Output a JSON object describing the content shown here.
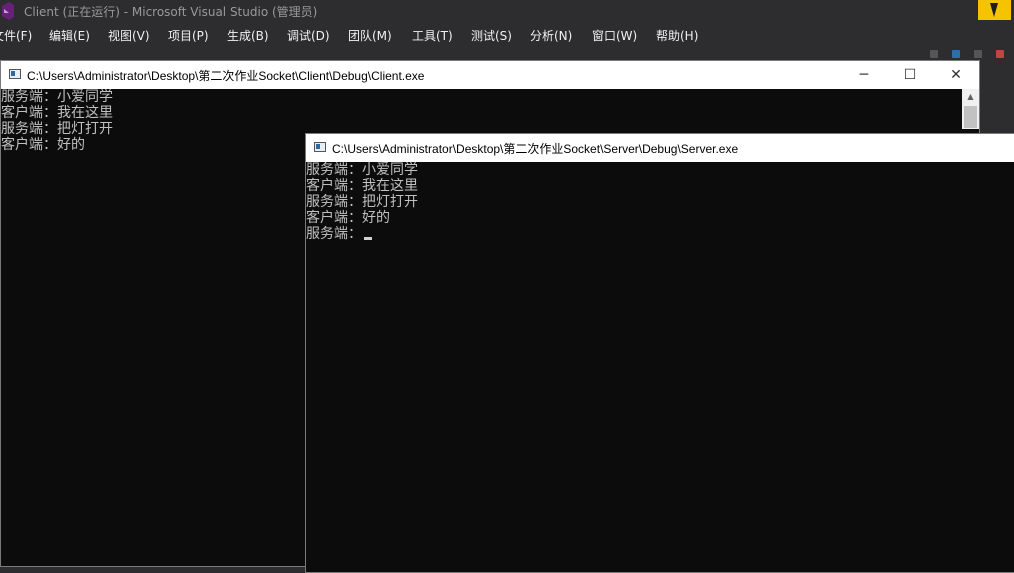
{
  "vs": {
    "title": "Client (正在运行) - Microsoft Visual Studio (管理员)",
    "menu": [
      "文件(F)",
      "编辑(E)",
      "视图(V)",
      "项目(P)",
      "生成(B)",
      "调试(D)",
      "团队(M)",
      "工具(T)",
      "测试(S)",
      "分析(N)",
      "窗口(W)",
      "帮助(H)"
    ]
  },
  "client": {
    "title": "C:\\Users\\Administrator\\Desktop\\第二次作业Socket\\Client\\Debug\\Client.exe",
    "lines": [
      "服务端：小爱同学",
      "客户端：我在这里",
      "服务端：把灯打开",
      "客户端：好的"
    ]
  },
  "server": {
    "title": "C:\\Users\\Administrator\\Desktop\\第二次作业Socket\\Server\\Debug\\Server.exe",
    "lines": [
      "服务端：小爱同学",
      "客户端：我在这里",
      "服务端：把灯打开",
      "客户端：好的",
      "服务端："
    ]
  },
  "window_buttons": {
    "minimize": "─",
    "maximize": "☐",
    "close": "✕"
  },
  "colors": {
    "console_bg": "#0c0c0c",
    "console_text": "#c0c0c0",
    "vs_bg": "#2d2d30",
    "accent_badge": "#f5c400"
  }
}
